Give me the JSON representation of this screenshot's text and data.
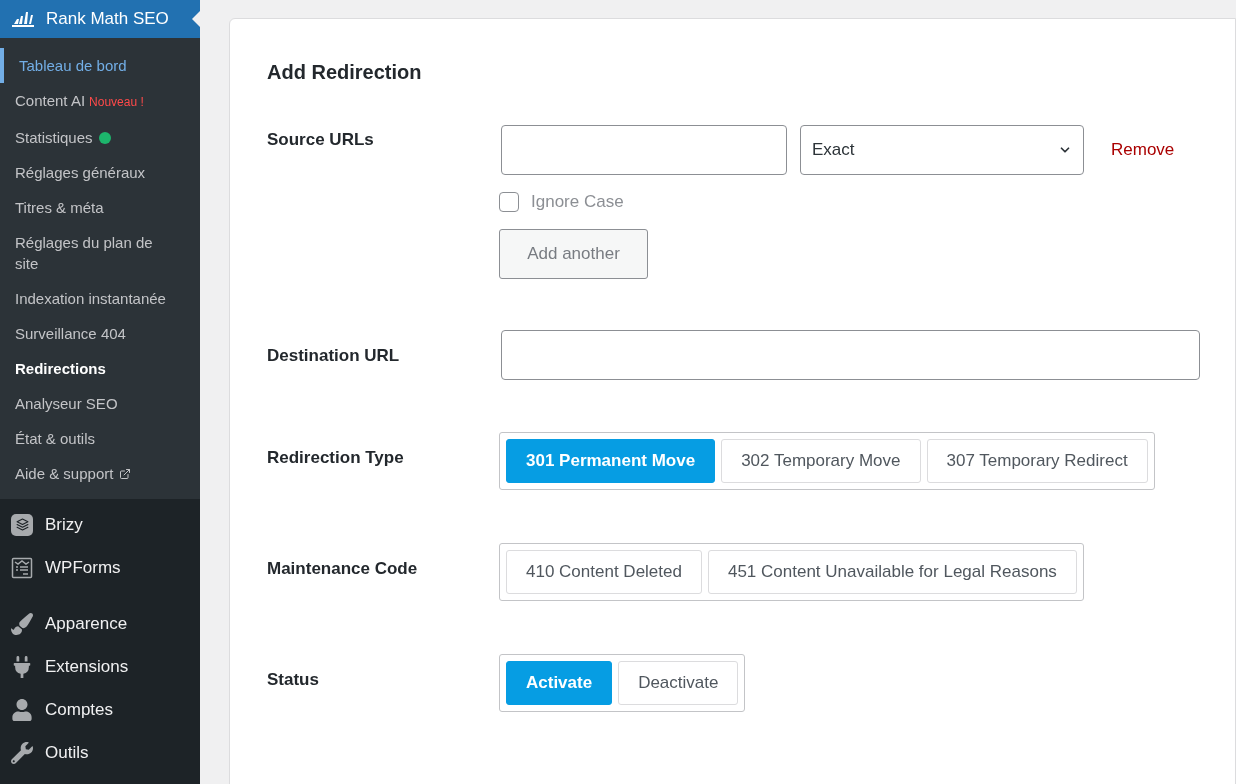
{
  "sidebar": {
    "header": {
      "label": "Rank Math SEO"
    },
    "submenu": [
      {
        "label": "Tableau de bord",
        "kind": "text",
        "highlighted": true,
        "selected": false
      },
      {
        "label": "Content AI",
        "kind": "badge",
        "badge": "Nouveau !",
        "highlighted": false,
        "selected": false
      },
      {
        "label": "Statistiques",
        "kind": "dot",
        "color": "#1db56c",
        "highlighted": false,
        "selected": false
      },
      {
        "label": "Réglages généraux",
        "kind": "text",
        "highlighted": false,
        "selected": false
      },
      {
        "label": "Titres & méta",
        "kind": "text",
        "highlighted": false,
        "selected": false
      },
      {
        "label": "Réglages du plan de site",
        "kind": "text",
        "highlighted": false,
        "selected": false
      },
      {
        "label": "Indexation instantanée",
        "kind": "text",
        "highlighted": false,
        "selected": false
      },
      {
        "label": "Surveillance 404",
        "kind": "text",
        "highlighted": false,
        "selected": false
      },
      {
        "label": "Redirections",
        "kind": "text",
        "highlighted": false,
        "selected": true
      },
      {
        "label": "Analyseur SEO",
        "kind": "text",
        "highlighted": false,
        "selected": false
      },
      {
        "label": "État & outils",
        "kind": "text",
        "highlighted": false,
        "selected": false
      },
      {
        "label": "Aide & support",
        "kind": "external",
        "highlighted": false,
        "selected": false
      }
    ],
    "menu": [
      {
        "label": "Brizy",
        "kind": "layers"
      },
      {
        "label": "WPForms",
        "kind": "form"
      },
      {
        "label": "Apparence",
        "kind": "brush"
      },
      {
        "label": "Extensions",
        "kind": "plug"
      },
      {
        "label": "Comptes",
        "kind": "user"
      },
      {
        "label": "Outils",
        "kind": "wrench"
      }
    ]
  },
  "form": {
    "title": "Add Redirection",
    "source_urls": {
      "label": "Source URLs",
      "match": "Exact",
      "remove": "Remove",
      "ignore_case": {
        "label": "Ignore Case",
        "checked": false
      },
      "add_button": "Add another"
    },
    "destination": {
      "label": "Destination URL"
    },
    "redirection_type": {
      "label": "Redirection Type",
      "options": [
        {
          "label": "301 Permanent Move",
          "selected": true
        },
        {
          "label": "302 Temporary Move",
          "selected": false
        },
        {
          "label": "307 Temporary Redirect",
          "selected": false
        }
      ]
    },
    "maintenance_code": {
      "label": "Maintenance Code",
      "options": [
        {
          "label": "410 Content Deleted",
          "selected": false
        },
        {
          "label": "451 Content Unavailable for Legal Reasons",
          "selected": false
        }
      ]
    },
    "status": {
      "label": "Status",
      "options": [
        {
          "label": "Activate",
          "selected": true
        },
        {
          "label": "Deactivate",
          "selected": false
        }
      ]
    }
  }
}
